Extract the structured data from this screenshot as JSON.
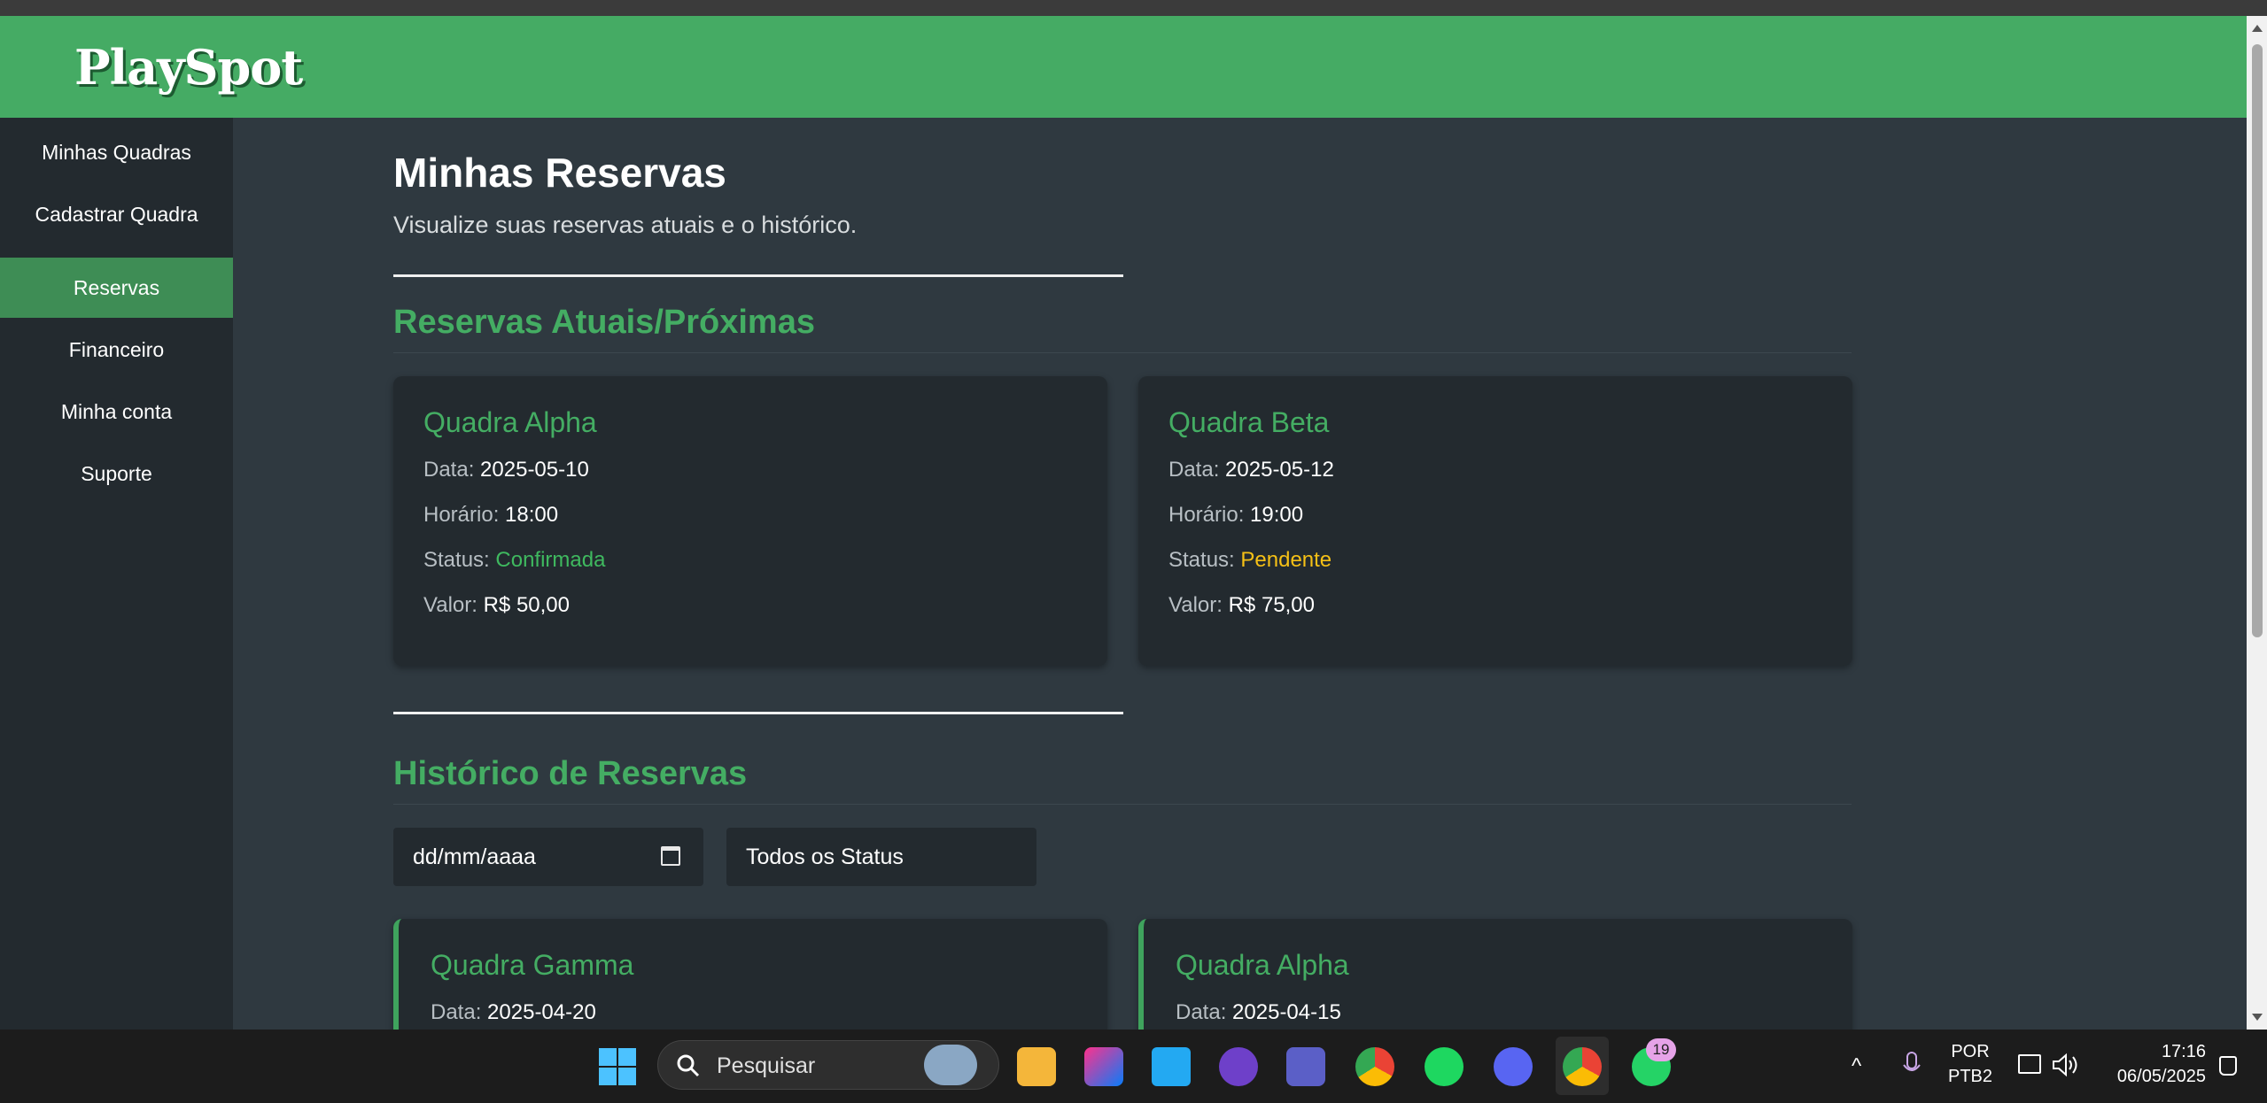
{
  "app": {
    "logo": "PlaySpot"
  },
  "sidebar": {
    "items": [
      {
        "label": "Minhas Quadras",
        "active": false
      },
      {
        "label": "Cadastrar Quadra",
        "active": false
      },
      {
        "label": "Reservas",
        "active": true
      },
      {
        "label": "Financeiro",
        "active": false
      },
      {
        "label": "Minha conta",
        "active": false
      },
      {
        "label": "Suporte",
        "active": false
      }
    ]
  },
  "page": {
    "title": "Minhas Reservas",
    "subtitle": "Visualize suas reservas atuais e o histórico."
  },
  "current": {
    "title": "Reservas Atuais/Próximas",
    "labels": {
      "date": "Data:",
      "time": "Horário:",
      "status": "Status:",
      "value": "Valor:"
    },
    "cards": [
      {
        "name": "Quadra Alpha",
        "date": "2025-05-10",
        "time": "18:00",
        "status": "Confirmada",
        "value": "R$ 50,00"
      },
      {
        "name": "Quadra Beta",
        "date": "2025-05-12",
        "time": "19:00",
        "status": "Pendente",
        "value": "R$ 75,00"
      }
    ]
  },
  "history": {
    "title": "Histórico de Reservas",
    "date_filter_placeholder": "dd/mm/aaaa",
    "status_filter": "Todos os Status",
    "cards": [
      {
        "name": "Quadra Gamma",
        "date": "2025-04-20"
      },
      {
        "name": "Quadra Alpha",
        "date": "2025-04-15"
      }
    ]
  },
  "colors": {
    "accent": "#45ab64",
    "confirmed": "#3fb95f",
    "pending": "#f5c016",
    "sidebar_bg": "#232a2f",
    "main_bg": "#2f3940"
  },
  "taskbar": {
    "search_label": "Pesquisar",
    "whatsapp_badge": "19",
    "lang_line1": "POR",
    "lang_line2": "PTB2",
    "time": "17:16",
    "date": "06/05/2025"
  }
}
